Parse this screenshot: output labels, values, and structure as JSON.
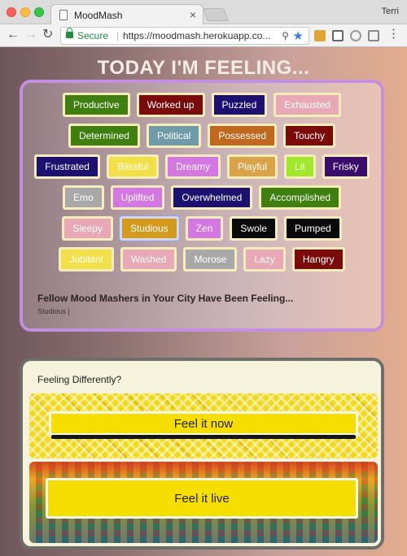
{
  "browser": {
    "tab_title": "MoodMash",
    "profile_name": "Terri",
    "secure_label": "Secure",
    "url": "https://moodmash.herokuapp.co..."
  },
  "page": {
    "heading": "TODAY I'M FEELING...",
    "moods": [
      {
        "label": "Productive",
        "color": "#3f7f10"
      },
      {
        "label": "Worked up",
        "color": "#7b0a0a"
      },
      {
        "label": "Puzzled",
        "color": "#1c1170"
      },
      {
        "label": "Exhausted",
        "color": "#e8a8b5"
      },
      {
        "label": "Determined",
        "color": "#3f7f10"
      },
      {
        "label": "Political",
        "color": "#6f9aa8"
      },
      {
        "label": "Possessed",
        "color": "#c0681e"
      },
      {
        "label": "Touchy",
        "color": "#7b0a0a"
      },
      {
        "label": "Frustrated",
        "color": "#1c1170"
      },
      {
        "label": "Blissful",
        "color": "#f2e049"
      },
      {
        "label": "Dreamy",
        "color": "#d577e3"
      },
      {
        "label": "Playful",
        "color": "#daa348"
      },
      {
        "label": "Lit",
        "color": "#9fe82a"
      },
      {
        "label": "Frisky",
        "color": "#3a0c6e"
      },
      {
        "label": "Emo",
        "color": "#a8a8a8"
      },
      {
        "label": "Uplifted",
        "color": "#d577e3"
      },
      {
        "label": "Overwhelmed",
        "color": "#1c1170"
      },
      {
        "label": "Accomplished",
        "color": "#3f7f10"
      },
      {
        "label": "Sleepy",
        "color": "#e8a8b5"
      },
      {
        "label": "Studious",
        "color": "#d49a1c",
        "selected": true
      },
      {
        "label": "Zen",
        "color": "#d577e3"
      },
      {
        "label": "Swole",
        "color": "#0a0a0a"
      },
      {
        "label": "Pumped",
        "color": "#0a0a0a"
      },
      {
        "label": "Jubilant",
        "color": "#f2e049"
      },
      {
        "label": "Washed",
        "color": "#e8a8b5"
      },
      {
        "label": "Morose",
        "color": "#a8a8a8"
      },
      {
        "label": "Lazy",
        "color": "#e8a8b5"
      },
      {
        "label": "Hangry",
        "color": "#7b0a0a"
      }
    ],
    "city_section": {
      "title": "Fellow Mood Mashers in Your City Have Been Feeling...",
      "moods_text": "Studious |"
    },
    "feeling_differently": {
      "title": "Feeling Differently?",
      "feel_now_label": "Feel it now",
      "feel_live_label": "Feel it live"
    }
  }
}
